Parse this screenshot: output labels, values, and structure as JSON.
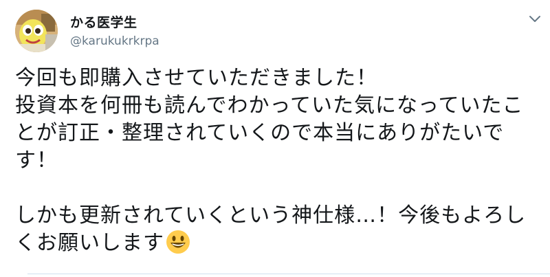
{
  "tweet": {
    "author": {
      "display_name": "かる医学生",
      "handle": "@karukukrkrpa",
      "avatar_icon": "character-avatar-icon"
    },
    "menu_icon": "chevron-down-icon",
    "body": {
      "lines": [
        "今回も即購入させていただきました！",
        "投資本を何冊も読んでわかっていた気になっていたこ",
        "とが訂正・整理されていくので本当にありがたいで",
        "す！",
        "",
        "しかも更新されていくという神仕様…！今後もよろし",
        "くお願いします"
      ],
      "emoji": "grinning-face-emoji"
    },
    "colors": {
      "text": "#14171a",
      "secondary": "#657786",
      "accent_caret": "#657786",
      "divider": "#cfe0ef"
    }
  }
}
